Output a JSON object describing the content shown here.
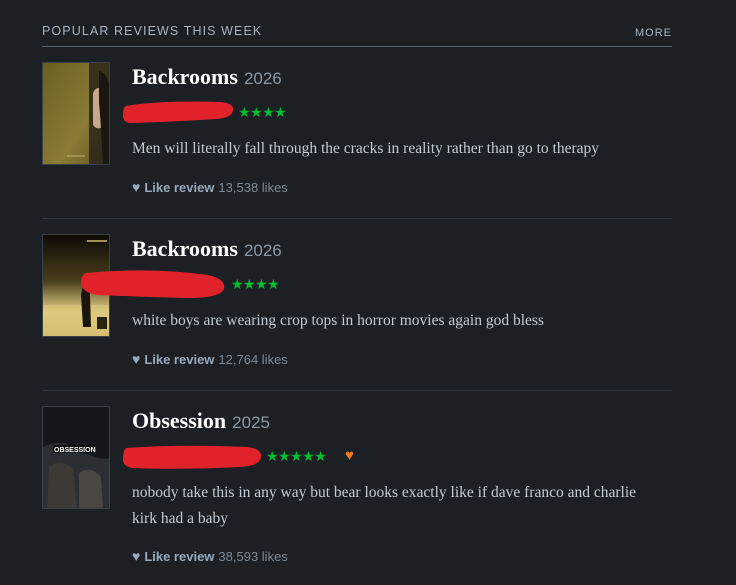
{
  "header": {
    "title": "POPULAR REVIEWS THIS WEEK",
    "more_label": "MORE"
  },
  "colors": {
    "background": "#1c1f23",
    "star_green": "#00c030",
    "liked_orange": "#ee7722",
    "redaction_red": "#e0232b"
  },
  "reviews": [
    {
      "film_title": "Backrooms",
      "year": "2026",
      "rating_stars": 4,
      "stars_text": "★★★★",
      "liked": false,
      "text": "Men will literally fall through the cracks in reality rather than go to therapy",
      "like_label": "Like review",
      "like_count": "13,538 likes"
    },
    {
      "film_title": "Backrooms",
      "year": "2026",
      "rating_stars": 4,
      "stars_text": "★★★★",
      "liked": false,
      "text": "white boys are wearing crop tops in horror movies again god bless",
      "like_label": "Like review",
      "like_count": "12,764 likes"
    },
    {
      "film_title": "Obsession",
      "year": "2025",
      "rating_stars": 5,
      "stars_text": "★★★★★",
      "liked": true,
      "liked_icon": "♥",
      "text": "nobody take this in any way but bear looks exactly like if dave franco and charlie kirk had a baby",
      "like_label": "Like review",
      "like_count": "38,593 likes"
    }
  ]
}
